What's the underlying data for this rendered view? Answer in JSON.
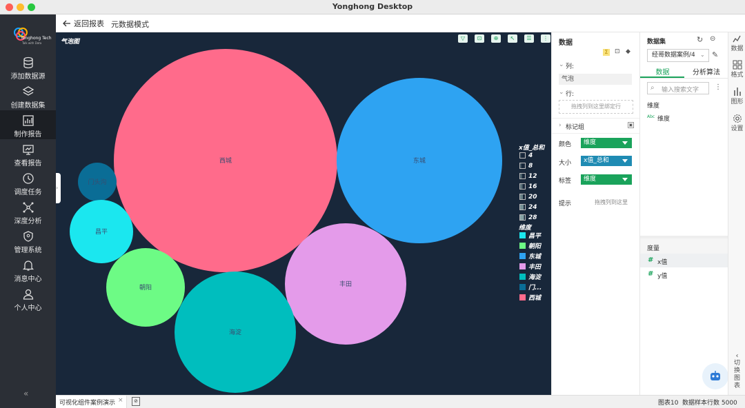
{
  "window": {
    "title": "Yonghong Desktop"
  },
  "logo": {
    "name": "Yonghong Tech",
    "tagline": "Talk with Data"
  },
  "nav": {
    "items": [
      {
        "label": "添加数据源",
        "icon": "database-icon"
      },
      {
        "label": "创建数据集",
        "icon": "layers-icon"
      },
      {
        "label": "制作报告",
        "icon": "bar-chart-icon"
      },
      {
        "label": "查看报告",
        "icon": "monitor-icon"
      },
      {
        "label": "调度任务",
        "icon": "clock-icon"
      },
      {
        "label": "深度分析",
        "icon": "network-icon"
      },
      {
        "label": "管理系统",
        "icon": "shield-icon"
      },
      {
        "label": "消息中心",
        "icon": "bell-icon"
      },
      {
        "label": "个人中心",
        "icon": "user-icon"
      }
    ],
    "active_index": 2,
    "collapse_glyph": "«"
  },
  "topbar": {
    "back_label": "返回报表",
    "meta_label": "元数据模式"
  },
  "chart_data": {
    "type": "bubble",
    "title": "气泡图",
    "size_field": "x值_总和",
    "color_field": "维度",
    "bubbles": [
      {
        "label": "西城",
        "color": "#ff6b8b"
      },
      {
        "label": "东城",
        "color": "#2ea3f2"
      },
      {
        "label": "门头沟",
        "color": "#0a6d96"
      },
      {
        "label": "昌平",
        "color": "#1be7ef"
      },
      {
        "label": "丰田",
        "color": "#e49bea"
      },
      {
        "label": "朝阳",
        "color": "#6dfb85"
      },
      {
        "label": "海淀",
        "color": "#00bebe"
      }
    ],
    "size_legend": [
      "4",
      "8",
      "12",
      "16",
      "20",
      "24",
      "28"
    ],
    "color_legend": [
      "昌平",
      "朝阳",
      "东城",
      "丰田",
      "海淀",
      "门...",
      "西城"
    ]
  },
  "props": {
    "header": "数据",
    "columns_label": "列:",
    "columns_value": "气泡",
    "rows_label": "行:",
    "rows_placeholder": "拖拽列到这里绑定行",
    "marks_label": "标记组",
    "color_label": "颜色",
    "color_value": "维度",
    "size_label": "大小",
    "size_value": "x值_总和",
    "tag_label": "标签",
    "tag_value": "维度",
    "tip_label": "提示",
    "tip_placeholder": "拖拽列到这里"
  },
  "dataset": {
    "header": "数据集",
    "selected": "经哥数据案例/4",
    "tab_data": "数据",
    "tab_algo": "分析算法",
    "search_placeholder": "输入搜索文字",
    "dims_header": "维度",
    "dims": [
      {
        "tag": "Abc",
        "name": "维度"
      }
    ],
    "measures_header": "度量",
    "measures": [
      {
        "tag": "#",
        "name": "x值"
      },
      {
        "tag": "#",
        "name": "y值"
      }
    ]
  },
  "rightrail": {
    "items": [
      {
        "label": "数据"
      },
      {
        "label": "格式"
      },
      {
        "label": "图形"
      },
      {
        "label": "设置"
      }
    ],
    "switch_chart": "切换图表"
  },
  "statusbar": {
    "tab_label": "可视化组件案例演示",
    "chart_count": "图表10",
    "sample_rows": "数据样本行数 5000"
  },
  "colors": {
    "accent": "#1aa35b",
    "nav_bg": "#2b2f36",
    "canvas_bg": "#18273a",
    "size_select": "#1f8bb3"
  }
}
